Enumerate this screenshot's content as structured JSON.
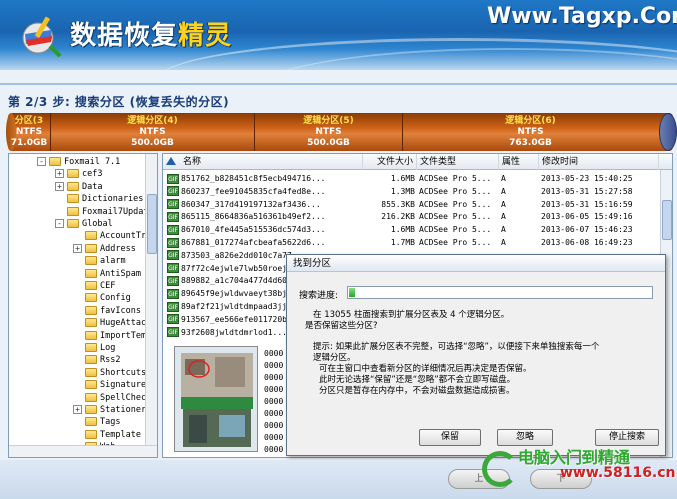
{
  "header": {
    "title_main": "数据恢复",
    "title_accent": "精灵",
    "site": "Www.Tagxp.Com"
  },
  "step": "第 2/3 步: 搜索分区 (恢复丢失的分区)",
  "partitions": [
    {
      "label": "分区(3",
      "fs": "NTFS",
      "size": "71.0GB"
    },
    {
      "label": "逻辑分区(4)",
      "fs": "NTFS",
      "size": "500.0GB"
    },
    {
      "label": "逻辑分区(5)",
      "fs": "NTFS",
      "size": "500.0GB"
    },
    {
      "label": "逻辑分区(6)",
      "fs": "NTFS",
      "size": "763.0GB"
    }
  ],
  "tree": {
    "items": [
      {
        "label": "Foxmail 7.1",
        "exp": "-"
      },
      {
        "label": "cef3",
        "exp": "+"
      },
      {
        "label": "Data",
        "exp": "+"
      },
      {
        "label": "Dictionaries",
        "exp": ""
      },
      {
        "label": "Foxmail7Updat",
        "exp": ""
      },
      {
        "label": "Global",
        "exp": "-"
      },
      {
        "label": "AccountTre",
        "exp": ""
      },
      {
        "label": "Address",
        "exp": "+"
      },
      {
        "label": "alarm",
        "exp": ""
      },
      {
        "label": "AntiSpam",
        "exp": ""
      },
      {
        "label": "CEF",
        "exp": ""
      },
      {
        "label": "Config",
        "exp": ""
      },
      {
        "label": "favIcons",
        "exp": ""
      },
      {
        "label": "HugeAttach",
        "exp": ""
      },
      {
        "label": "ImportTemp",
        "exp": ""
      },
      {
        "label": "Log",
        "exp": ""
      },
      {
        "label": "Rss2",
        "exp": ""
      },
      {
        "label": "Shortcuts",
        "exp": ""
      },
      {
        "label": "Signatures",
        "exp": ""
      },
      {
        "label": "SpellCheck",
        "exp": ""
      },
      {
        "label": "Stationery",
        "exp": "+"
      },
      {
        "label": "Tags",
        "exp": ""
      },
      {
        "label": "Template",
        "exp": ""
      },
      {
        "label": "Web",
        "exp": ""
      }
    ]
  },
  "list": {
    "columns": [
      "名称",
      "文件大小",
      "文件类型",
      "属性",
      "修改时间"
    ],
    "rows": [
      {
        "name": "851762_b828451c8f5ecb494716...",
        "size": "1.6MB",
        "type": "ACDSee Pro 5...",
        "attr": "A",
        "time": "2013-05-23 15:40:25"
      },
      {
        "name": "860237_fee91045835cfa4fed8e...",
        "size": "1.3MB",
        "type": "ACDSee Pro 5...",
        "attr": "A",
        "time": "2013-05-31 15:27:58"
      },
      {
        "name": "860347_317d419197132af3436...",
        "size": "855.3KB",
        "type": "ACDSee Pro 5...",
        "attr": "A",
        "time": "2013-05-31 15:16:59"
      },
      {
        "name": "865115_8664836a516361b49ef2...",
        "size": "216.2KB",
        "type": "ACDSee Pro 5...",
        "attr": "A",
        "time": "2013-06-05 15:49:16"
      },
      {
        "name": "867010_4fe445a515536dc574d3...",
        "size": "1.6MB",
        "type": "ACDSee Pro 5...",
        "attr": "A",
        "time": "2013-06-07 15:46:23"
      },
      {
        "name": "867881_017274afcbeafa5622d6...",
        "size": "1.7MB",
        "type": "ACDSee Pro 5...",
        "attr": "A",
        "time": "2013-06-08 16:49:23"
      },
      {
        "name": "873503_a826e2dd010c7a77...",
        "size": "",
        "type": "",
        "attr": "",
        "time": ""
      },
      {
        "name": "87f72c4ejwle7lwb50roej2...",
        "size": "",
        "type": "",
        "attr": "",
        "time": ""
      },
      {
        "name": "889882_a1c704a477d4d6019...",
        "size": "",
        "type": "",
        "attr": "",
        "time": ""
      },
      {
        "name": "89645f9ejwldwvaeyt38bji...",
        "size": "",
        "type": "",
        "attr": "",
        "time": ""
      },
      {
        "name": "89af2f21jwldtdmpaad3jj...",
        "size": "",
        "type": "",
        "attr": "",
        "time": ""
      },
      {
        "name": "913567_ee566efe011720b4...",
        "size": "",
        "type": "",
        "attr": "",
        "time": ""
      },
      {
        "name": "93f2608jwldtdmrlod1...",
        "size": "",
        "type": "",
        "attr": "",
        "time": ""
      }
    ],
    "hex": [
      "0000",
      "0000",
      "0000",
      "0000",
      "0000",
      "0000",
      "0000",
      "0000",
      "0000"
    ]
  },
  "dialog": {
    "title": "找到分区",
    "progress_label": "搜索进度:",
    "progress": 0.02,
    "lines": [
      "在 13055 柱面搜索到扩展分区表及 4 个逻辑分区。",
      "是否保留这些分区?",
      "提示: 如果此扩展分区表不完整，可选择“忽略”，以便接下来单独搜索每一个",
      "逻辑分区。",
      "可在主窗口中查看新分区的详细情况后再决定是否保留。",
      "此时无论选择“保留”还是“忽略”都不会立即写磁盘。",
      "分区只是暂存在内存中，不会对磁盘数据造成损害。"
    ],
    "buttons": {
      "keep": "保留",
      "ignore": "忽略",
      "stop": "停止搜索"
    }
  },
  "bottom": {
    "prev": "上",
    "next": "下"
  },
  "watermark": {
    "line1": "电脑入门到精通",
    "line2": "www.58116.cn"
  },
  "colors": {
    "accent": "#1a64b0",
    "partition": "#d06418",
    "progress": "#2aa52a"
  }
}
